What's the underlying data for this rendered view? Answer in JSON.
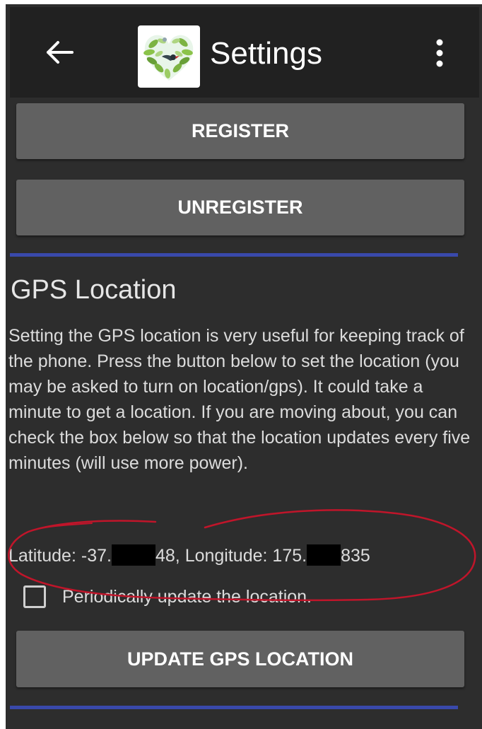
{
  "colors": {
    "background": "#2d2d2d",
    "appbar": "#212121",
    "button": "#616161",
    "divider": "#3949ab",
    "annotation": "#c0152a"
  },
  "appbar": {
    "back_icon": "arrow-back-icon",
    "logo_icon": "heart-leaves-bird-logo",
    "title": "Settings",
    "overflow_icon": "more-vert-icon"
  },
  "buttons": {
    "register": "REGISTER",
    "unregister": "UNREGISTER",
    "update_gps": "UPDATE GPS LOCATION"
  },
  "gps": {
    "title": "GPS Location",
    "description": "Setting the GPS location is very useful for keeping track of the phone. Press the button below to set the location (you may be asked to turn on location/gps). It could take a minute to get a location. If you are moving about, you can check the box below so that the location updates every five minutes (will use more power).",
    "latitude_label": "Latitude:",
    "latitude_prefix": "-37.",
    "latitude_suffix": "48,",
    "longitude_label": "Longitude:",
    "longitude_prefix": "175.",
    "longitude_suffix": "835",
    "periodic_label": "Periodically update the location.",
    "periodic_checked": false
  }
}
